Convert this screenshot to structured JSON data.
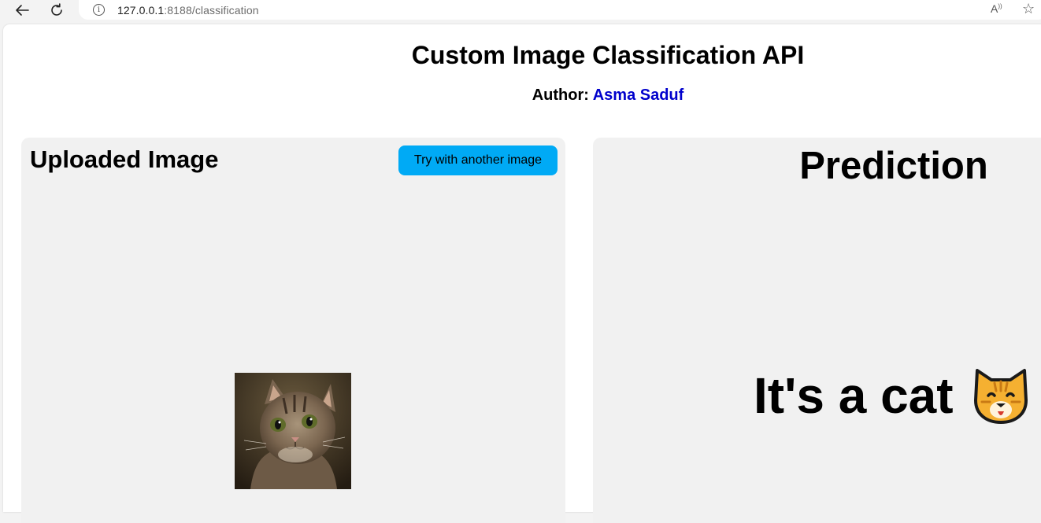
{
  "browser": {
    "url_host": "127.0.0.1",
    "url_rest": ":8188/classification"
  },
  "header": {
    "title": "Custom Image Classification API",
    "author_label": "Author:",
    "author_name": "Asma Saduf"
  },
  "upload_panel": {
    "title": "Uploaded Image",
    "button_label": "Try with another image"
  },
  "prediction_panel": {
    "title": "Prediction",
    "result": "It's a cat"
  },
  "colors": {
    "accent_button": "#00aaf5",
    "author_link": "#0000cc",
    "panel_bg": "#f1f1f1"
  },
  "icons": {
    "back": "back-arrow-icon",
    "reload": "reload-icon",
    "info": "info-icon",
    "read_aloud": "read-aloud-icon",
    "favorite": "star-icon",
    "cat_emoji": "cat-face-emoji-icon"
  }
}
